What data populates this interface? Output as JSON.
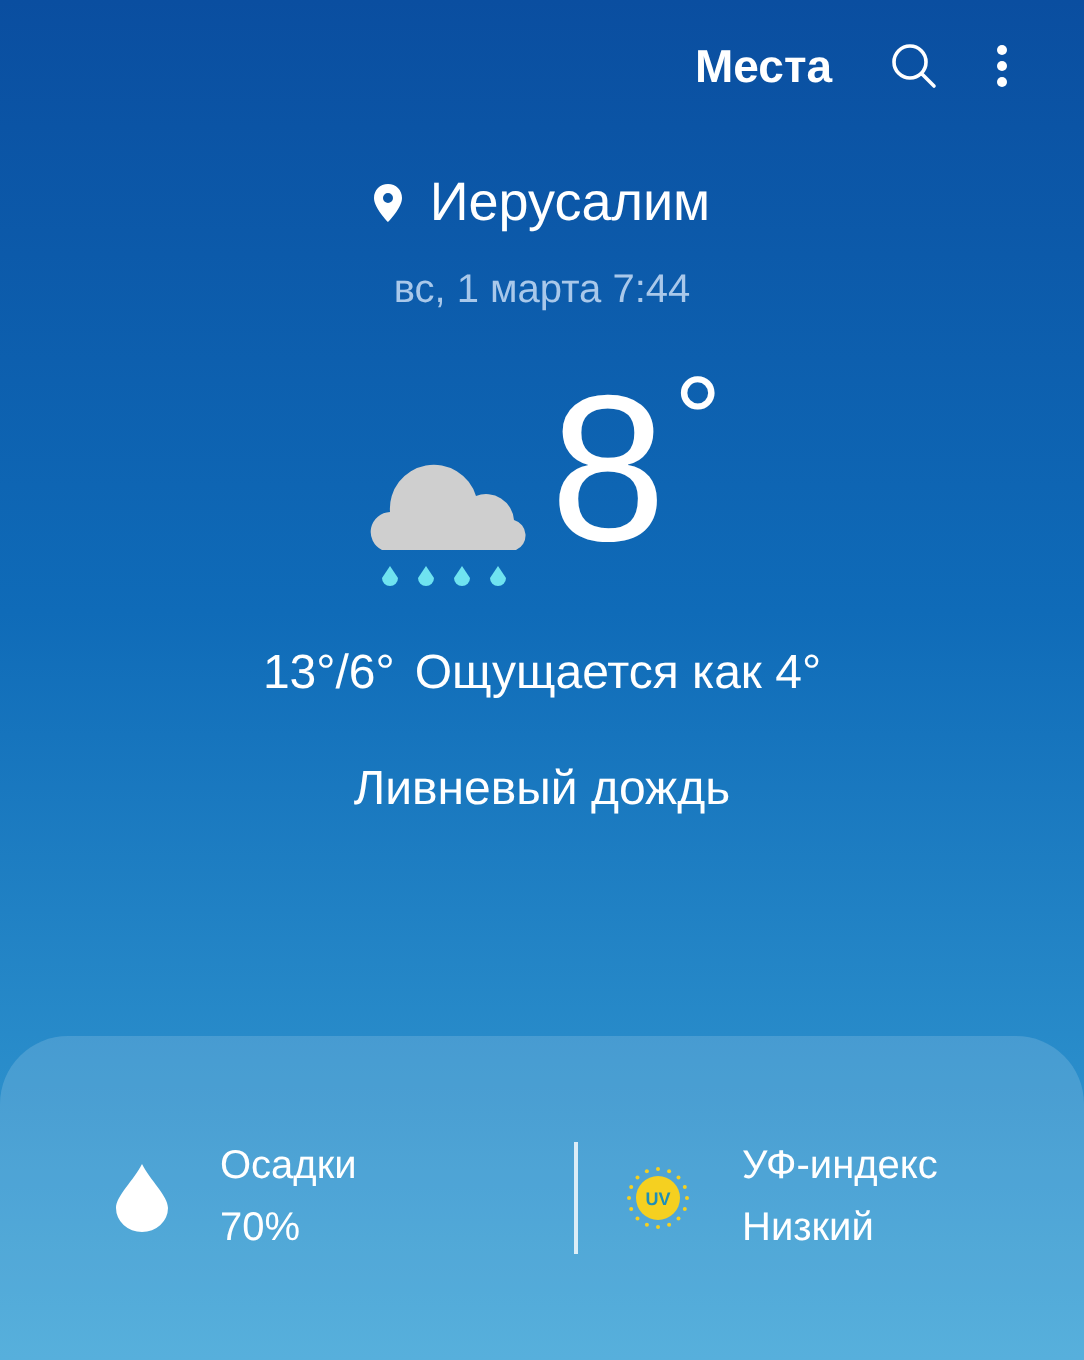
{
  "top_bar": {
    "places_link": "Места"
  },
  "location": {
    "city": "Иерусалим",
    "datetime": "вс, 1 марта 7:44"
  },
  "current": {
    "temperature": "8",
    "unit": "°",
    "range": "13°/6°",
    "feels_like": "Ощущается как 4°",
    "condition": "Ливневый дождь"
  },
  "details": [
    {
      "kind": "precipitation",
      "label": "Осадки",
      "value": "70%"
    },
    {
      "kind": "uv",
      "label": "УФ-индекс",
      "value": "Низкий",
      "icon_text": "UV"
    }
  ]
}
